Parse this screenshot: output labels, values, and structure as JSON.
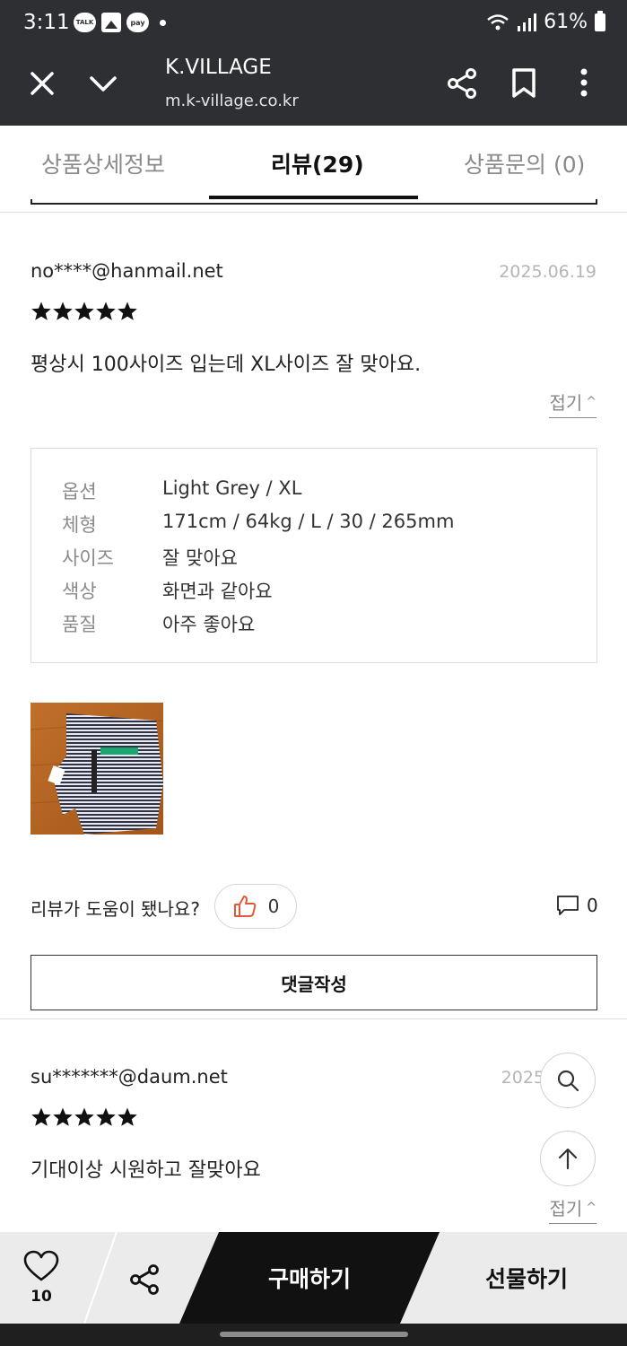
{
  "status_bar": {
    "time": "3:11",
    "notification_talk": "TALK",
    "notification_pay": "pay",
    "battery": "61%"
  },
  "browser": {
    "title": "K.VILLAGE",
    "url": "m.k-village.co.kr"
  },
  "tabs": [
    {
      "label": "상품상세정보",
      "active": false
    },
    {
      "label": "리뷰(29)",
      "active": true
    },
    {
      "label": "상품문의 (0)",
      "active": false
    }
  ],
  "reviews": [
    {
      "user": "no****@hanmail.net",
      "date": "2025.06.19",
      "rating": 5,
      "text": "평상시 100사이즈 입는데 XL사이즈 잘 맞아요.",
      "fold_label": "접기",
      "options": [
        {
          "label": "옵션",
          "value": "Light Grey / XL"
        },
        {
          "label": "체형",
          "value": "171cm / 64kg / L / 30 / 265mm"
        },
        {
          "label": "사이즈",
          "value": "잘 맞아요"
        },
        {
          "label": "색상",
          "value": "화면과 같아요"
        },
        {
          "label": "품질",
          "value": "아주 좋아요"
        }
      ],
      "helpful_question": "리뷰가 도움이 됐나요?",
      "like_count": "0",
      "comment_count": "0",
      "write_comment_label": "댓글작성"
    },
    {
      "user": "su*******@daum.net",
      "date": "2025",
      "rating": 5,
      "text": "기대이상 시원하고 잘맞아요",
      "fold_label": "접기"
    }
  ],
  "bottom_bar": {
    "wishlist_count": "10",
    "buy_label": "구매하기",
    "gift_label": "선물하기"
  },
  "colors": {
    "header_bg": "#2d2f33",
    "buy_bg": "#111111",
    "like_icon": "#e05a3a"
  }
}
